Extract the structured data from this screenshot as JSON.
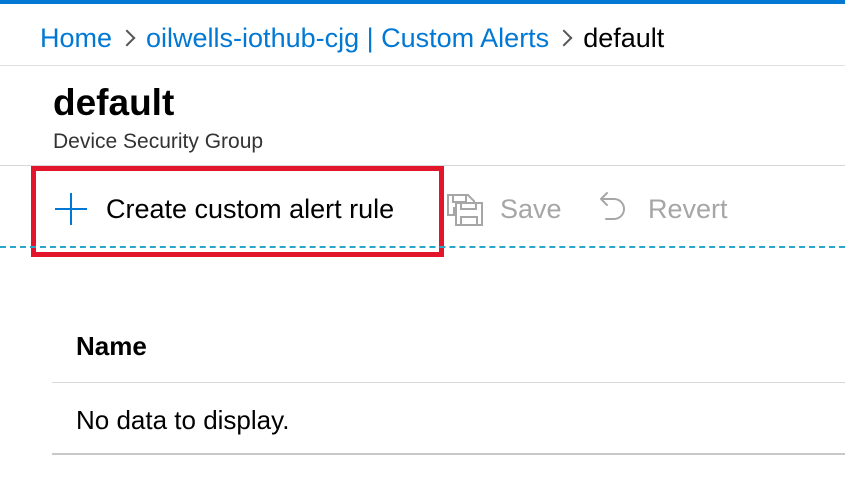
{
  "breadcrumb": {
    "home": "Home",
    "parent": "oilwells-iothub-cjg | Custom Alerts",
    "current": "default"
  },
  "header": {
    "title": "default",
    "subtitle": "Device Security Group"
  },
  "toolbar": {
    "create_label": "Create custom alert rule",
    "save_label": "Save",
    "revert_label": "Revert",
    "create_icon": "plus-icon",
    "save_icon": "save-icon",
    "revert_icon": "undo-icon",
    "highlighted": "create_label"
  },
  "table": {
    "columns": [
      "Name"
    ],
    "empty_message": "No data to display."
  },
  "colors": {
    "accent": "#0078d4",
    "highlight_border": "#e3152b",
    "disabled_text": "#a6a6a6",
    "progress_dash": "#2aa7c8"
  }
}
